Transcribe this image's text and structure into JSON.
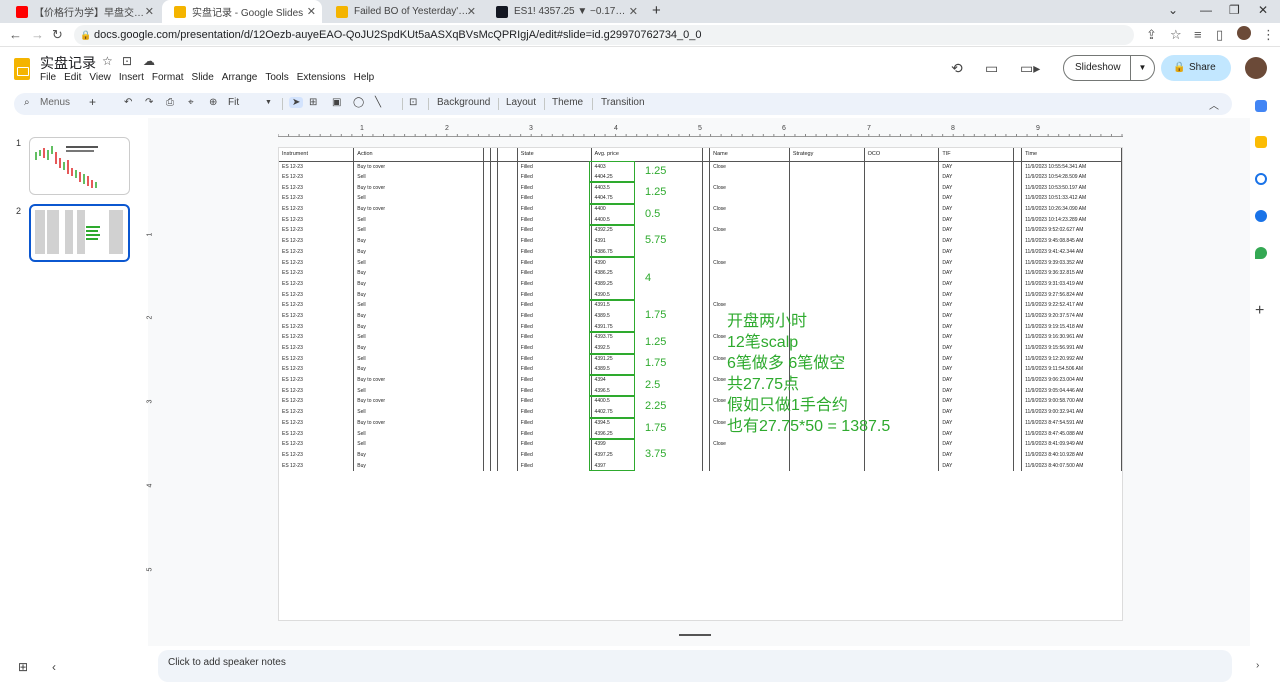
{
  "browser": {
    "tabs": [
      {
        "title": "【价格行为学】早盘交易策略(1):",
        "fav_color": "#ff0000"
      },
      {
        "title": "实盘记录 - Google Slides",
        "fav_color": "#f4b400"
      },
      {
        "title": "Failed BO of Yesterday's High",
        "fav_color": "#f4b400"
      },
      {
        "title": "ES1! 4357.25 ▼ −0.17% Unnan",
        "fav_color": "#131722"
      }
    ],
    "new_tab": "+",
    "url": "docs.google.com/presentation/d/12Oezb-auyeEAO-QoJU2SpdKUt5aASXqBVsMcQPRIgjA/edit#slide=id.g29970762734_0_0"
  },
  "app": {
    "title": "实盘记录",
    "menus": [
      "File",
      "Edit",
      "View",
      "Insert",
      "Format",
      "Slide",
      "Arrange",
      "Tools",
      "Extensions",
      "Help"
    ],
    "slideshow_label": "Slideshow",
    "share_label": "Share"
  },
  "toolbar": {
    "menus_label": "Menus",
    "zoom": "Fit",
    "background": "Background",
    "layout": "Layout",
    "theme": "Theme",
    "transition": "Transition"
  },
  "filmstrip": {
    "numbers": [
      "1",
      "2"
    ]
  },
  "ruler": {
    "h": [
      "1",
      "2",
      "3",
      "4",
      "5",
      "6",
      "7",
      "8",
      "9"
    ],
    "v": [
      "1",
      "2",
      "3",
      "4",
      "5"
    ]
  },
  "table": {
    "headers": [
      "Instrument",
      "Action",
      "",
      "",
      "",
      "State",
      "Avg. price",
      "",
      "Name",
      "Strategy",
      "OCO",
      "TIF",
      "",
      "Time"
    ],
    "rows": [
      [
        "ES 12-23",
        "Buy to cover",
        "",
        "",
        "",
        "Filled",
        "4403",
        "",
        "Close",
        "",
        "",
        "DAY",
        "",
        "11/9/2023 10:55:54.341 AM"
      ],
      [
        "ES 12-23",
        "Sell",
        "",
        "",
        "",
        "Filled",
        "4404.25",
        "",
        "",
        "",
        "",
        "DAY",
        "",
        "11/9/2023 10:54:28.509 AM"
      ],
      [
        "ES 12-23",
        "Buy to cover",
        "",
        "",
        "",
        "Filled",
        "4403.5",
        "",
        "Close",
        "",
        "",
        "DAY",
        "",
        "11/9/2023 10:53:50.197 AM"
      ],
      [
        "ES 12-23",
        "Sell",
        "",
        "",
        "",
        "Filled",
        "4404.75",
        "",
        "",
        "",
        "",
        "DAY",
        "",
        "11/9/2023 10:51:33.412 AM"
      ],
      [
        "ES 12-23",
        "Buy to cover",
        "",
        "",
        "",
        "Filled",
        "4400",
        "",
        "Close",
        "",
        "",
        "DAY",
        "",
        "11/9/2023 10:26:34.090 AM"
      ],
      [
        "ES 12-23",
        "Sell",
        "",
        "",
        "",
        "Filled",
        "4400.5",
        "",
        "",
        "",
        "",
        "DAY",
        "",
        "11/9/2023 10:14:23.289 AM"
      ],
      [
        "ES 12-23",
        "Sell",
        "",
        "",
        "",
        "Filled",
        "4392.25",
        "",
        "Close",
        "",
        "",
        "DAY",
        "",
        "11/9/2023 9:52:02.627 AM"
      ],
      [
        "ES 12-23",
        "Buy",
        "",
        "",
        "",
        "Filled",
        "4391",
        "",
        "",
        "",
        "",
        "DAY",
        "",
        "11/9/2023 9:45:08.845 AM"
      ],
      [
        "ES 12-23",
        "Buy",
        "",
        "",
        "",
        "Filled",
        "4386.75",
        "",
        "",
        "",
        "",
        "DAY",
        "",
        "11/9/2023 9:41:42.344 AM"
      ],
      [
        "ES 12-23",
        "Sell",
        "",
        "",
        "",
        "Filled",
        "4390",
        "",
        "Close",
        "",
        "",
        "DAY",
        "",
        "11/9/2023 9:39:03.352 AM"
      ],
      [
        "ES 12-23",
        "Buy",
        "",
        "",
        "",
        "Filled",
        "4386.25",
        "",
        "",
        "",
        "",
        "DAY",
        "",
        "11/9/2023 9:36:32.815 AM"
      ],
      [
        "ES 12-23",
        "Buy",
        "",
        "",
        "",
        "Filled",
        "4389.25",
        "",
        "",
        "",
        "",
        "DAY",
        "",
        "11/9/2023 9:31:03.419 AM"
      ],
      [
        "ES 12-23",
        "Buy",
        "",
        "",
        "",
        "Filled",
        "4390.5",
        "",
        "",
        "",
        "",
        "DAY",
        "",
        "11/9/2023 9:27:56.824 AM"
      ],
      [
        "ES 12-23",
        "Sell",
        "",
        "",
        "",
        "Filled",
        "4391.5",
        "",
        "Close",
        "",
        "",
        "DAY",
        "",
        "11/9/2023 9:22:52.417 AM"
      ],
      [
        "ES 12-23",
        "Buy",
        "",
        "",
        "",
        "Filled",
        "4389.5",
        "",
        "",
        "",
        "",
        "DAY",
        "",
        "11/9/2023 9:20:37.574 AM"
      ],
      [
        "ES 12-23",
        "Buy",
        "",
        "",
        "",
        "Filled",
        "4391.75",
        "",
        "",
        "",
        "",
        "DAY",
        "",
        "11/9/2023 9:19:15.418 AM"
      ],
      [
        "ES 12-23",
        "Sell",
        "",
        "",
        "",
        "Filled",
        "4393.75",
        "",
        "Close",
        "",
        "",
        "DAY",
        "",
        "11/9/2023 9:16:30.961 AM"
      ],
      [
        "ES 12-23",
        "Buy",
        "",
        "",
        "",
        "Filled",
        "4392.5",
        "",
        "",
        "",
        "",
        "DAY",
        "",
        "11/9/2023 9:15:56.991 AM"
      ],
      [
        "ES 12-23",
        "Sell",
        "",
        "",
        "",
        "Filled",
        "4391.25",
        "",
        "Close",
        "",
        "",
        "DAY",
        "",
        "11/9/2023 9:12:20.992 AM"
      ],
      [
        "ES 12-23",
        "Buy",
        "",
        "",
        "",
        "Filled",
        "4389.5",
        "",
        "",
        "",
        "",
        "DAY",
        "",
        "11/9/2023 9:11:54.506 AM"
      ],
      [
        "ES 12-23",
        "Buy to cover",
        "",
        "",
        "",
        "Filled",
        "4394",
        "",
        "Close",
        "",
        "",
        "DAY",
        "",
        "11/9/2023 9:06:23.004 AM"
      ],
      [
        "ES 12-23",
        "Sell",
        "",
        "",
        "",
        "Filled",
        "4396.5",
        "",
        "",
        "",
        "",
        "DAY",
        "",
        "11/9/2023 9:05:04.446 AM"
      ],
      [
        "ES 12-23",
        "Buy to cover",
        "",
        "",
        "",
        "Filled",
        "4400.5",
        "",
        "Close",
        "",
        "",
        "DAY",
        "",
        "11/9/2023 9:00:58.700 AM"
      ],
      [
        "ES 12-23",
        "Sell",
        "",
        "",
        "",
        "Filled",
        "4402.75",
        "",
        "",
        "",
        "",
        "DAY",
        "",
        "11/9/2023 9:00:32.941 AM"
      ],
      [
        "ES 12-23",
        "Buy to cover",
        "",
        "",
        "",
        "Filled",
        "4394.5",
        "",
        "Close",
        "",
        "",
        "DAY",
        "",
        "11/9/2023 8:47:54.591 AM"
      ],
      [
        "ES 12-23",
        "Sell",
        "",
        "",
        "",
        "Filled",
        "4396.25",
        "",
        "",
        "",
        "",
        "DAY",
        "",
        "11/9/2023 8:47:45.088 AM"
      ],
      [
        "ES 12-23",
        "Sell",
        "",
        "",
        "",
        "Filled",
        "4399",
        "",
        "Close",
        "",
        "",
        "DAY",
        "",
        "11/9/2023 8:41:09.949 AM"
      ],
      [
        "ES 12-23",
        "Buy",
        "",
        "",
        "",
        "Filled",
        "4397.25",
        "",
        "",
        "",
        "",
        "DAY",
        "",
        "11/9/2023 8:40:10.928 AM"
      ],
      [
        "ES 12-23",
        "Buy",
        "",
        "",
        "",
        "Filled",
        "4397",
        "",
        "",
        "",
        "",
        "DAY",
        "",
        "11/9/2023 8:40:07.500 AM"
      ]
    ]
  },
  "annotations": {
    "diffs": [
      "1.25",
      "1.25",
      "0.5",
      "5.75",
      "4",
      "1.75",
      "1.25",
      "1.75",
      "2.5",
      "2.25",
      "1.75",
      "3.75"
    ],
    "summary": [
      "开盘两小时",
      "12笔scalp",
      "6笔做多 6笔做空",
      "共27.75点",
      "假如只做1手合约",
      "也有27.75*50 = 1387.5"
    ],
    "color": "#2eaa2e"
  },
  "speaker_notes_placeholder": "Click to add speaker notes"
}
